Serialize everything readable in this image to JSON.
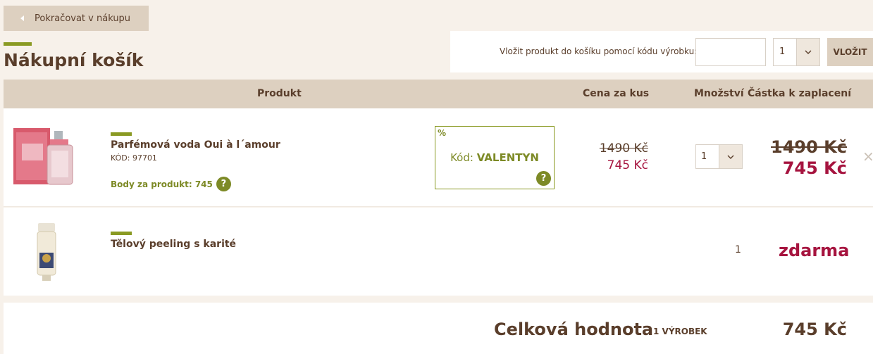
{
  "nav": {
    "back_label": "Pokračovat v nákupu"
  },
  "page": {
    "title": "Nákupní košík"
  },
  "code_form": {
    "label": "Vložit produkt do košíku pomocí kódu výrobku:",
    "code_value": "",
    "qty_value": "1",
    "submit_label": "VLOŽIT"
  },
  "table": {
    "col_product": "Produkt",
    "col_unit_price": "Cena za kus",
    "col_qty": "Množství",
    "col_total": "Částka k zaplacení"
  },
  "items": [
    {
      "name": "Parfémová voda Oui à l´amour",
      "code": "KÓD: 97701",
      "points_label": "Body za produkt: 745",
      "promo_pct": "%",
      "promo_prefix": "Kód:",
      "promo_code": "VALENTYN",
      "unit_old_price": "1490 Kč",
      "unit_new_price": "745 Kč",
      "qty": "1",
      "total_old": "1490 Kč",
      "total_new": "745 Kč",
      "remove": "×"
    },
    {
      "name": "Tělový peeling s karité",
      "qty": "1",
      "total": "zdarma"
    }
  ],
  "summary": {
    "label": "Celková hodnota",
    "count": "1 VÝROBEK",
    "total": "745 Kč"
  },
  "colors": {
    "accent_green": "#8a9a23",
    "price_red": "#a6143f",
    "text_brown": "#5a3e2b",
    "header_beige": "#ddd0c0"
  },
  "icons": {
    "back": "caret-left-icon",
    "select": "chevron-down-icon",
    "help": "question-icon",
    "remove": "close-icon"
  }
}
